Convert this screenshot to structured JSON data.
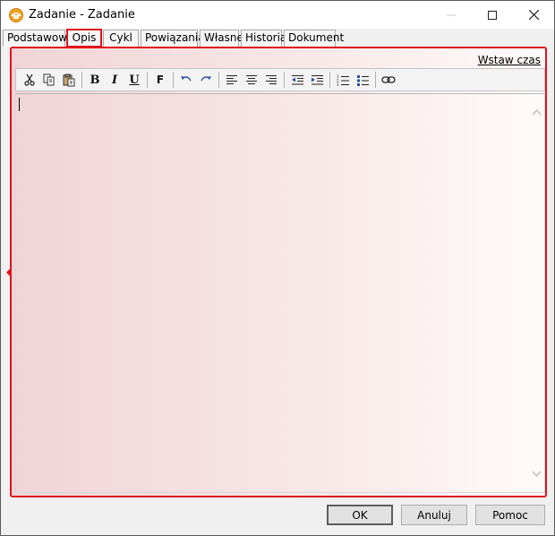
{
  "window": {
    "title": "Zadanie - Zadanie"
  },
  "tabs": [
    {
      "label": "Podstawowe"
    },
    {
      "label": "Opis"
    },
    {
      "label": "Cykl"
    },
    {
      "label": "Powiązania"
    },
    {
      "label": "Własne"
    },
    {
      "label": "Historia"
    },
    {
      "label": "Dokument"
    }
  ],
  "active_tab": "Opis",
  "panel": {
    "insert_time_link": "Wstaw czas"
  },
  "toolbar": {
    "bold": "B",
    "italic": "I",
    "underline": "U",
    "font": "F"
  },
  "editor": {
    "content": ""
  },
  "footer": {
    "ok_label": "OK",
    "cancel_label": "Anuluj",
    "help_label": "Pomoc"
  },
  "colors": {
    "highlight": "#e0141e",
    "panel_gradient_start": "#f2d4d6",
    "panel_gradient_end": "#fefbfa"
  }
}
